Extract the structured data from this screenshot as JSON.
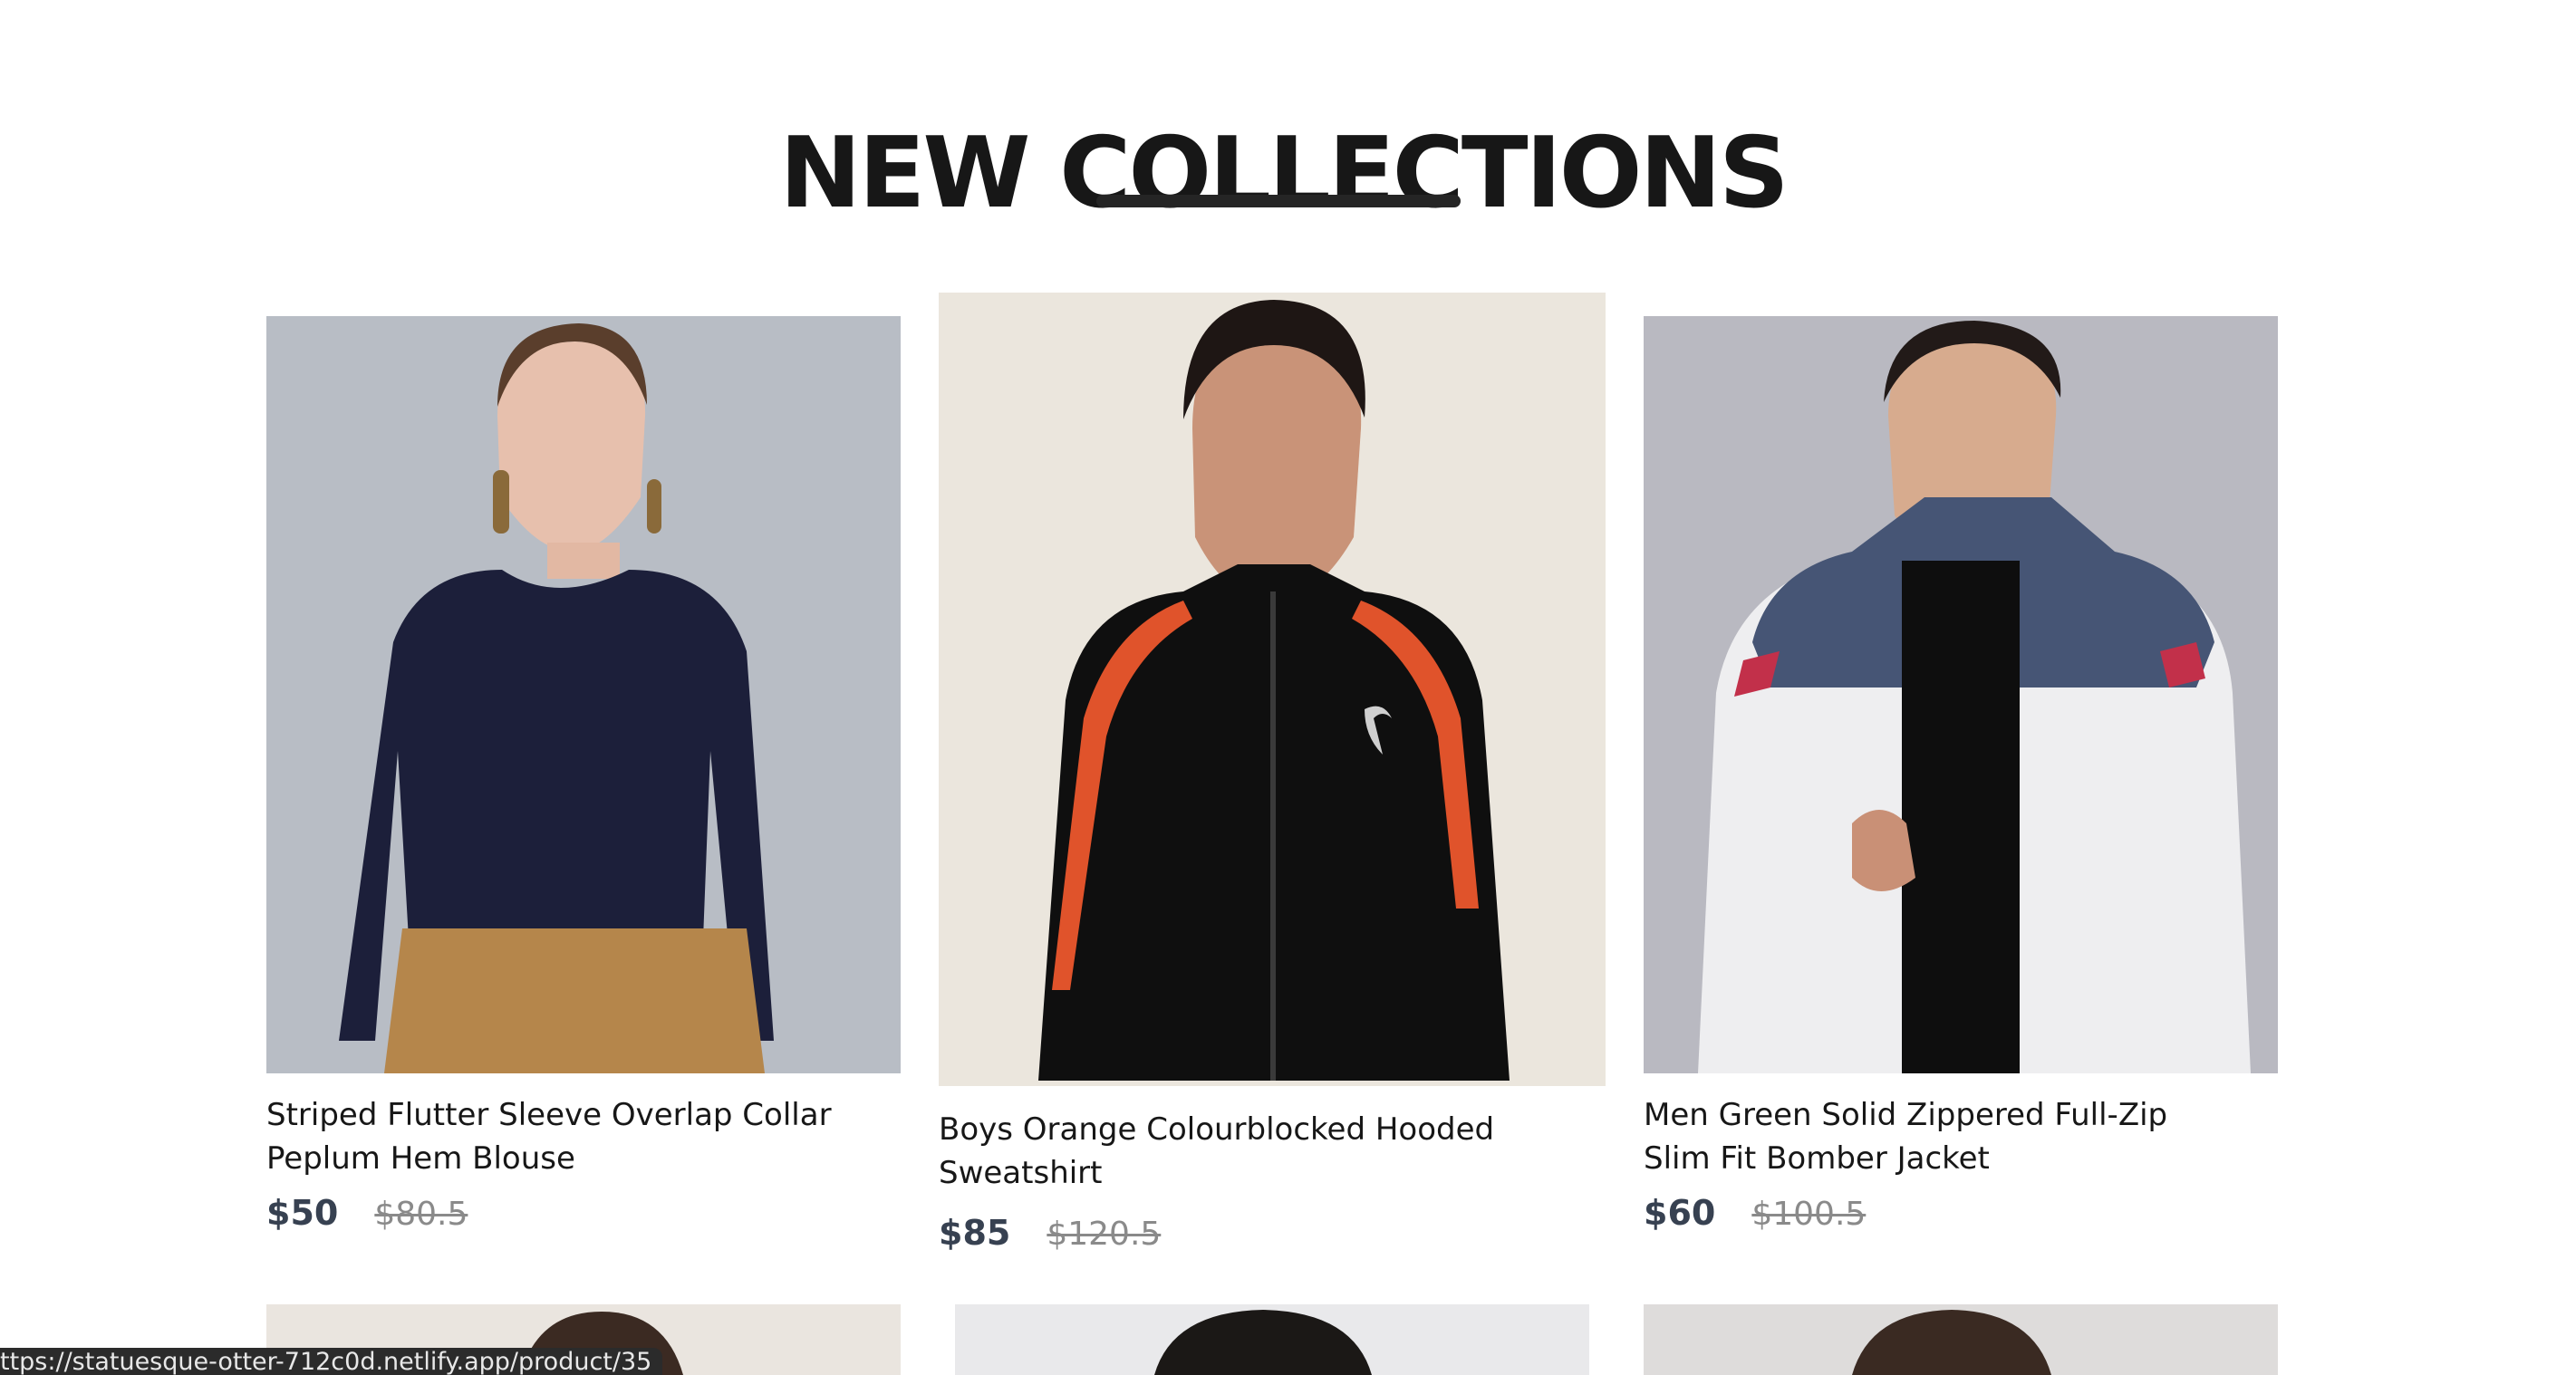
{
  "section": {
    "title": "NEW COLLECTIONS"
  },
  "products": [
    {
      "name": "Striped Flutter Sleeve Overlap Collar Peplum Hem Blouse",
      "price": "$50",
      "old_price": "$80.5",
      "image_bg": "#b7bcc4"
    },
    {
      "name": "Boys Orange Colourblocked Hooded Sweatshirt",
      "price": "$85",
      "old_price": "$120.5",
      "image_bg": "#ebe5dc"
    },
    {
      "name": "Men Green Solid Zippered Full-Zip Slim Fit Bomber Jacket",
      "price": "$60",
      "old_price": "$100.5",
      "image_bg": "#b9b9c0"
    }
  ],
  "status_bar": {
    "url": "ttps://statuesque-otter-712c0d.netlify.app/product/35"
  }
}
